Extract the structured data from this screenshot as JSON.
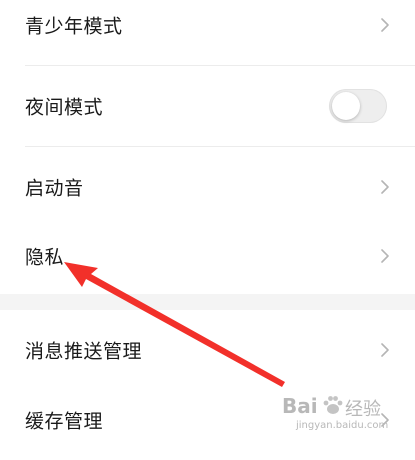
{
  "settings": {
    "items": [
      {
        "label": "青少年模式",
        "control": "chevron"
      },
      {
        "label": "夜间模式",
        "control": "toggle",
        "on": false
      },
      {
        "label": "启动音",
        "control": "chevron"
      },
      {
        "label": "隐私",
        "control": "chevron"
      },
      {
        "label": "消息推送管理",
        "control": "chevron"
      },
      {
        "label": "缓存管理",
        "control": "chevron"
      }
    ]
  },
  "watermark": {
    "brand": "Bai",
    "brand_cn": "经验",
    "url": "jingyan.baidu.com"
  },
  "colors": {
    "annotation_arrow": "#f2302a",
    "chevron": "#b5b5b5",
    "toggle_track": "#eeeeee",
    "section_gap": "#f4f4f4"
  }
}
